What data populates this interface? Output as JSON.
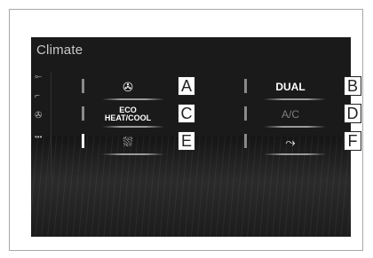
{
  "screen": {
    "title": "Climate"
  },
  "sidebar": {
    "items": [
      {
        "icon": "seat-heater-icon",
        "glyph": "⟜"
      },
      {
        "icon": "seat-fan-icon",
        "glyph": "⌐"
      },
      {
        "icon": "fan-icon",
        "glyph": "✇"
      },
      {
        "icon": "more-icon",
        "glyph": "•••"
      }
    ]
  },
  "buttons": {
    "fan_speed": {
      "icon": "fan-icon",
      "glyph": "✇"
    },
    "eco_line1": "ECO",
    "eco_line2": "HEAT/COOL",
    "defroster": {
      "icon": "windshield-defroster-icon",
      "glyph": "⛆"
    },
    "dual_label": "DUAL",
    "ac_label": "A/C",
    "airflow": {
      "icon": "airflow-mode-icon",
      "glyph": "⤳"
    }
  },
  "callouts": {
    "a": "A",
    "b": "B",
    "c": "C",
    "d": "D",
    "e": "E",
    "f": "F"
  }
}
